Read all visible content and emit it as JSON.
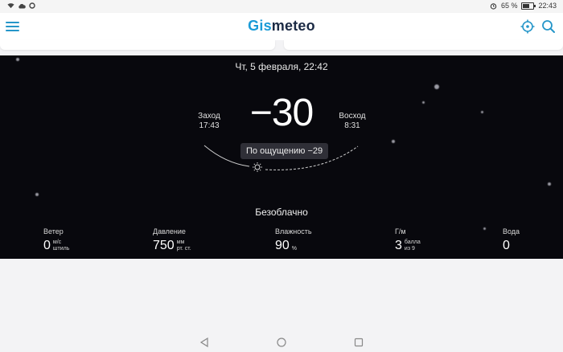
{
  "status_bar": {
    "battery_percent": "65 %",
    "battery_level": 0.65,
    "time": "22:43",
    "icons": [
      "wifi-icon",
      "cloud-icon",
      "sync-icon",
      "alarm-icon",
      "battery-icon"
    ]
  },
  "header": {
    "logo_part1": "Gis",
    "logo_part2": "meteo",
    "logo_color1": "#1a9bd7",
    "logo_color2": "#1b2a44",
    "icons": [
      "menu-icon",
      "location-icon",
      "search-icon"
    ]
  },
  "weather": {
    "datetime": "Чт, 5 февраля, 22:42",
    "temperature": "−30",
    "sunset_label": "Заход",
    "sunset_time": "17:43",
    "sunrise_label": "Восход",
    "sunrise_time": "8:31",
    "feels_like": "По ощущению −29",
    "condition": "Безоблачно",
    "metrics": {
      "wind": {
        "label": "Ветер",
        "value": "0",
        "unit1": "м/с",
        "unit2": "штиль"
      },
      "pressure": {
        "label": "Давление",
        "value": "750",
        "unit1": "мм",
        "unit2": "рт. ст."
      },
      "humidity": {
        "label": "Влажность",
        "value": "90",
        "unit1": "%",
        "unit2": ""
      },
      "geomag": {
        "label": "Г/м",
        "value": "3",
        "unit1": "балла",
        "unit2": "из 9"
      },
      "water": {
        "label": "Вода",
        "value": "0",
        "unit1": "",
        "unit2": ""
      }
    }
  },
  "navbar": {
    "icons": [
      "back-icon",
      "home-icon",
      "recents-icon"
    ]
  }
}
